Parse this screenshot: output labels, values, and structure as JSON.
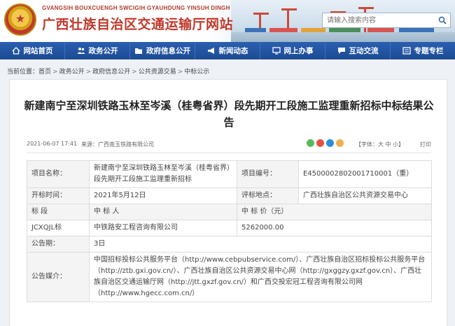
{
  "header": {
    "site_subtitle": "GVANGSIH BOUXCUENGH SWCIGIH GYAUHDUNG YINSUH DINGH",
    "site_title": "广西壮族自治区交通运输厅网站",
    "search_placeholder": "请输入搜索内容"
  },
  "nav": {
    "items": [
      {
        "label": "网站首页",
        "icon": "home-icon"
      },
      {
        "label": "政务公开",
        "icon": "people-icon"
      },
      {
        "label": "政府信息公开",
        "icon": "folder-icon"
      },
      {
        "label": "新闻动态",
        "icon": "megaphone-icon"
      },
      {
        "label": "网上办事",
        "icon": "monitor-icon"
      },
      {
        "label": "互动交流",
        "icon": "chat-icon"
      },
      {
        "label": "专题专栏",
        "icon": "bookmark-icon"
      }
    ]
  },
  "breadcrumb": {
    "prefix": "当前位置：",
    "items": [
      "首页",
      "政务公开",
      "政府信息公开",
      "公共资源交易",
      "中标公示"
    ]
  },
  "article": {
    "title": "新建南宁至深圳铁路玉林至岑溪（桂粤省界）段先期开工段施工监理重新招标中标结果公告",
    "date": "2021-06-07 17:41",
    "source": "来源：广西南玉铁路有限公司",
    "font_size": "【字体：大 中 小】",
    "print": "打印"
  },
  "table": {
    "project_name_label": "项目名称：",
    "project_name": "新建南宁至深圳铁路玉林至岑溪（桂粤省界）段先期开工段施工监理重新招标",
    "project_no_label": "项目编号：",
    "project_no": "E4500002802001710001（重）",
    "open_time_label": "开标时间：",
    "open_time": "2021年5月12日",
    "eval_place_label": "评标地点：",
    "eval_place": "广西壮族自治区公共资源交易中心",
    "section_header": "标 段",
    "winner_header": "中 标 人",
    "price_header": "中 标 价（元）",
    "section": "JCXQJL标",
    "winner": "中铁路安工程咨询有限公司",
    "price": "5262000.00",
    "period_label": "公告期：",
    "period": "3日",
    "media_label": "公告媒介：",
    "media": "中国招标投标公共服务平台（http://www.cebpubservice.com/）、广西壮族自治区招标投标公共服务平台（http://ztb.gxi.gov.cn/）、广西壮族自治区公共资源交易中心网（http://gxggzy.gxzf.gov.cn）、广西壮族自治区交通运输厅网（http://jtt.gxzf.gov.cn/）和广西交投宏冠工程咨询有限公司网（http://www.hgecc.com.cn/）"
  },
  "colors": {
    "brand_red": "#c0392b",
    "nav_blue": "#1d4b93"
  }
}
